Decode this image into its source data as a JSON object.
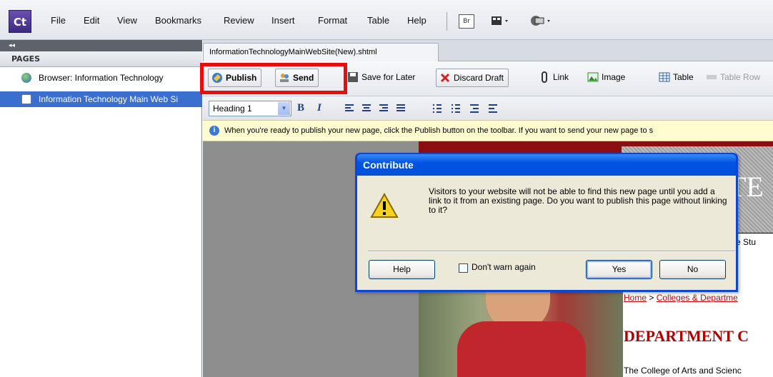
{
  "app": {
    "logo": "Ct"
  },
  "menu": [
    "File",
    "Edit",
    "View",
    "Bookmarks",
    "Review",
    "Insert",
    "Format",
    "Table",
    "Help"
  ],
  "toolbar_extra": {
    "br_label": "Br"
  },
  "pages_panel": {
    "toggle": "◂◂",
    "tab": "PAGES",
    "items": [
      {
        "label": "Browser: Information Technology"
      },
      {
        "label": "Information Technology Main Web Si"
      }
    ]
  },
  "document": {
    "tab_title": "InformationTechnologyMainWebSite(New).shtml"
  },
  "toolbar": {
    "publish": "Publish",
    "send": "Send",
    "save_for_later": "Save for Later",
    "discard_draft": "Discard Draft",
    "link": "Link",
    "image": "Image",
    "table": "Table",
    "table_row": "Table Row"
  },
  "format_bar": {
    "style_value": "Heading 1",
    "bold": "B",
    "italic": "I"
  },
  "info_bar": {
    "text": "When you're ready to publish your new page, click the Publish button on the toolbar. If you want to send your new page to s"
  },
  "page_content": {
    "banner_letters": "TE",
    "nav_fragment": "tive Stu",
    "breadcrumb_home": "Home",
    "breadcrumb_sep": " > ",
    "breadcrumb_link": "Colleges & Departme",
    "heading": "DEPARTMENT C",
    "body": "The College of Arts and Scienc"
  },
  "dialog": {
    "title": "Contribute",
    "message": "Visitors to your website will not be able to find this new page until you add a link to it from an existing page. Do you want to publish this page without linking to it?",
    "help": "Help",
    "dont_warn": "Don't warn again",
    "yes": "Yes",
    "no": "No"
  },
  "colors": {
    "highlight": "#e40e0e",
    "title_blue": "#0054e3",
    "site_red": "#8a0f12"
  }
}
